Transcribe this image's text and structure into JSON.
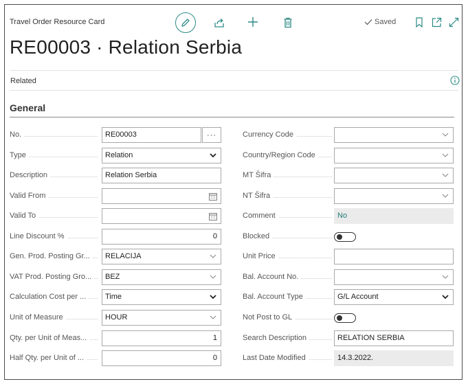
{
  "header": {
    "caption": "Travel Order Resource Card",
    "status": "Saved",
    "title": "RE00003 · Relation Serbia",
    "icons": {
      "edit": "pencil-icon",
      "share": "share-icon",
      "new": "plus-icon",
      "delete": "trash-icon",
      "saved": "check-icon",
      "bookmark": "bookmark-icon",
      "popout": "popout-icon",
      "expand": "expand-icon"
    }
  },
  "related": {
    "label": "Related",
    "icon": "info-icon"
  },
  "section": {
    "title": "General"
  },
  "left_fields": [
    {
      "label": "No.",
      "value": "RE00003",
      "kind": "assist",
      "assist": "···"
    },
    {
      "label": "Type",
      "value": "Relation",
      "kind": "select-dark"
    },
    {
      "label": "Description",
      "value": "Relation Serbia",
      "kind": "text"
    },
    {
      "label": "Valid From",
      "value": "",
      "kind": "date"
    },
    {
      "label": "Valid To",
      "value": "",
      "kind": "date"
    },
    {
      "label": "Line Discount %",
      "value": "0",
      "kind": "number"
    },
    {
      "label": "Gen. Prod. Posting Gr...",
      "value": "RELACIJA",
      "kind": "lookup"
    },
    {
      "label": "VAT Prod. Posting Gro...",
      "value": "BEZ",
      "kind": "lookup"
    },
    {
      "label": "Calculation Cost per ...",
      "value": "Time",
      "kind": "select-dark"
    },
    {
      "label": "Unit of Measure",
      "value": "HOUR",
      "kind": "lookup"
    },
    {
      "label": "Qty. per Unit of Meas...",
      "value": "1",
      "kind": "number"
    },
    {
      "label": "Half Qty. per Unit of ...",
      "value": "0",
      "kind": "number"
    }
  ],
  "right_fields": [
    {
      "label": "Currency Code",
      "value": "",
      "kind": "lookup"
    },
    {
      "label": "Country/Region Code",
      "value": "",
      "kind": "lookup"
    },
    {
      "label": "MT Šifra",
      "value": "",
      "kind": "lookup"
    },
    {
      "label": "NT Šifra",
      "value": "",
      "kind": "lookup"
    },
    {
      "label": "Comment",
      "value": "No",
      "kind": "readonly-link"
    },
    {
      "label": "Blocked",
      "value": "",
      "kind": "toggle",
      "state": "off"
    },
    {
      "label": "Unit Price",
      "value": "",
      "kind": "text"
    },
    {
      "label": "Bal. Account No.",
      "value": "",
      "kind": "lookup"
    },
    {
      "label": "Bal. Account Type",
      "value": "G/L Account",
      "kind": "select-dark"
    },
    {
      "label": "Not Post to GL",
      "value": "",
      "kind": "toggle",
      "state": "off"
    },
    {
      "label": "Search Description",
      "value": "RELATION SERBIA",
      "kind": "text"
    },
    {
      "label": "Last Date Modified",
      "value": "14.3.2022.",
      "kind": "readonly"
    }
  ],
  "colors": {
    "accent": "#2a8a85",
    "link": "#1f7c77",
    "readonly_bg": "#ebebeb",
    "border": "#a8a8a8"
  }
}
